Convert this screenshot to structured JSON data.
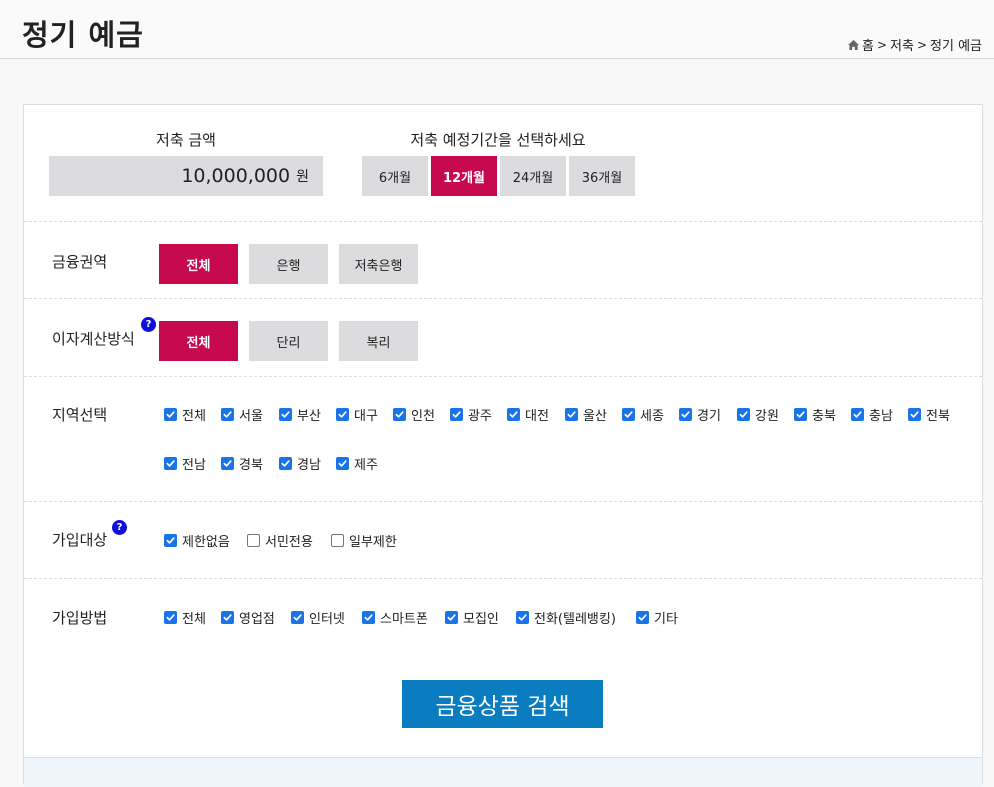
{
  "header": {
    "title": "정기 예금",
    "breadcrumb": [
      "홈",
      "저축",
      "정기 예금"
    ],
    "breadcrumb_sep": ">"
  },
  "amount": {
    "label": "저축 금액",
    "value": "10,000,000",
    "unit": "원"
  },
  "period": {
    "label": "저축 예정기간을 선택하세요",
    "options": [
      "6개월",
      "12개월",
      "24개월",
      "36개월"
    ],
    "selected": "12개월"
  },
  "sector": {
    "label": "금융권역",
    "options": [
      "전체",
      "은행",
      "저축은행"
    ],
    "selected": "전체"
  },
  "interest": {
    "label": "이자계산방식",
    "help": "?",
    "options": [
      "전체",
      "단리",
      "복리"
    ],
    "selected": "전체"
  },
  "region": {
    "label": "지역선택",
    "items": [
      {
        "label": "전체",
        "checked": true
      },
      {
        "label": "서울",
        "checked": true
      },
      {
        "label": "부산",
        "checked": true
      },
      {
        "label": "대구",
        "checked": true
      },
      {
        "label": "인천",
        "checked": true
      },
      {
        "label": "광주",
        "checked": true
      },
      {
        "label": "대전",
        "checked": true
      },
      {
        "label": "울산",
        "checked": true
      },
      {
        "label": "세종",
        "checked": true
      },
      {
        "label": "경기",
        "checked": true
      },
      {
        "label": "강원",
        "checked": true
      },
      {
        "label": "충북",
        "checked": true
      },
      {
        "label": "충남",
        "checked": true
      },
      {
        "label": "전북",
        "checked": true
      },
      {
        "label": "전남",
        "checked": true
      },
      {
        "label": "경북",
        "checked": true
      },
      {
        "label": "경남",
        "checked": true
      },
      {
        "label": "제주",
        "checked": true
      }
    ]
  },
  "target": {
    "label": "가입대상",
    "help": "?",
    "items": [
      {
        "label": "제한없음",
        "checked": true
      },
      {
        "label": "서민전용",
        "checked": false
      },
      {
        "label": "일부제한",
        "checked": false
      }
    ]
  },
  "method": {
    "label": "가입방법",
    "items": [
      {
        "label": "전체",
        "checked": true
      },
      {
        "label": "영업점",
        "checked": true
      },
      {
        "label": "인터넷",
        "checked": true
      },
      {
        "label": "스마트폰",
        "checked": true
      },
      {
        "label": "모집인",
        "checked": true
      },
      {
        "label": "전화(텔레뱅킹)",
        "checked": true
      },
      {
        "label": "기타",
        "checked": true
      }
    ]
  },
  "search": {
    "label": "금융상품 검색"
  },
  "colors": {
    "accent": "#c7094f",
    "search": "#0a7cc0",
    "checkbox": "#1a73e8",
    "help": "#1010d8"
  }
}
